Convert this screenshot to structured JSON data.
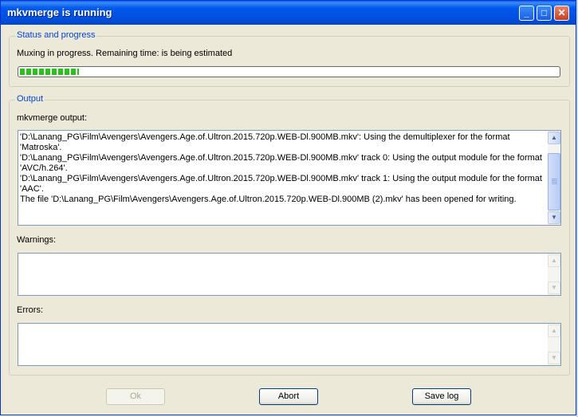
{
  "window": {
    "title": "mkvmerge is running",
    "controls": {
      "minimize": "_",
      "maximize": "□",
      "close": "✕"
    }
  },
  "status_group": {
    "legend": "Status and progress",
    "status_text": "Muxing in progress.  Remaining time:  is being estimated",
    "progress_fraction": 0.11
  },
  "output_group": {
    "legend": "Output",
    "output_label": "mkvmerge output:",
    "output_lines": [
      "'D:\\Lanang_PG\\Film\\Avengers\\Avengers.Age.of.Ultron.2015.720p.WEB-Dl.900MB.mkv': Using the demultiplexer for the format 'Matroska'.",
      "'D:\\Lanang_PG\\Film\\Avengers\\Avengers.Age.of.Ultron.2015.720p.WEB-Dl.900MB.mkv' track 0: Using the output module for the format 'AVC/h.264'.",
      "'D:\\Lanang_PG\\Film\\Avengers\\Avengers.Age.of.Ultron.2015.720p.WEB-Dl.900MB.mkv' track 1: Using the output module for the format 'AAC'.",
      "The file 'D:\\Lanang_PG\\Film\\Avengers\\Avengers.Age.of.Ultron.2015.720p.WEB-Dl.900MB (2).mkv' has been opened for writing."
    ],
    "warnings_label": "Warnings:",
    "errors_label": "Errors:"
  },
  "buttons": {
    "ok": "Ok",
    "abort": "Abort",
    "save_log": "Save log"
  },
  "icons": {
    "scroll_up": "scroll-up-arrow-icon",
    "scroll_down": "scroll-down-arrow-icon"
  },
  "colors": {
    "title_bar": "#0054e3",
    "group_legend": "#0046d5",
    "progress_fill": "#2dbf1f",
    "dialog_bg": "#ece9d8"
  }
}
